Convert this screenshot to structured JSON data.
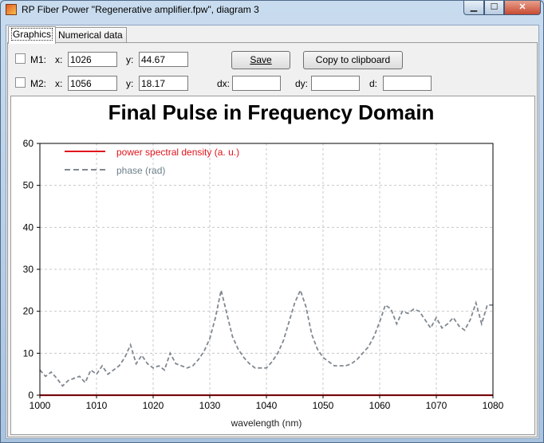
{
  "window": {
    "title": "RP Fiber Power \"Regenerative amplifier.fpw\", diagram 3",
    "controls": {
      "minimize": "▁",
      "maximize": "☐",
      "close": "✕"
    }
  },
  "tabs": [
    {
      "label": "Graphics",
      "active": true
    },
    {
      "label": "Numerical data",
      "active": false
    }
  ],
  "markers": {
    "m1": {
      "label": "M1:",
      "x_label": "x:",
      "x": "1026",
      "y_label": "y:",
      "y": "44.67",
      "checked": false
    },
    "m2": {
      "label": "M2:",
      "x_label": "x:",
      "x": "1056",
      "y_label": "y:",
      "y": "18.17",
      "checked": false
    },
    "dx_label": "dx:",
    "dx": "",
    "dy_label": "dy:",
    "dy": "",
    "d_label": "d:",
    "d": ""
  },
  "buttons": {
    "save": "Save",
    "copy": "Copy to clipboard"
  },
  "colors": {
    "psd": "#e0141c",
    "phase": "#808890",
    "legend_phase_text": "#6a7f8a",
    "grid": "#c8c8c8"
  },
  "chart_data": {
    "type": "line",
    "title": "Final Pulse in Frequency Domain",
    "xlabel": "wavelength (nm)",
    "ylabel": "",
    "xlim": [
      1000,
      1080
    ],
    "ylim": [
      0,
      60
    ],
    "xticks": [
      1000,
      1010,
      1020,
      1030,
      1040,
      1050,
      1060,
      1070,
      1080
    ],
    "yticks": [
      0,
      10,
      20,
      30,
      40,
      50,
      60
    ],
    "grid": true,
    "legend_position": "top-left",
    "series": [
      {
        "name": "power spectral density (a. u.)",
        "style": "solid",
        "x": [
          1000,
          1080
        ],
        "y": [
          0,
          0
        ]
      },
      {
        "name": "phase (rad)",
        "style": "dashed",
        "x": [
          1000,
          1001,
          1002,
          1003,
          1004,
          1005,
          1006,
          1007,
          1008,
          1009,
          1010,
          1011,
          1012,
          1013,
          1014,
          1015,
          1016,
          1017,
          1018,
          1019,
          1020,
          1021,
          1022,
          1023,
          1024,
          1025,
          1026,
          1027,
          1028,
          1029,
          1030,
          1031,
          1032,
          1033,
          1034,
          1035,
          1036,
          1037,
          1038,
          1039,
          1040,
          1041,
          1042,
          1043,
          1044,
          1045,
          1046,
          1047,
          1048,
          1049,
          1050,
          1051,
          1052,
          1053,
          1054,
          1055,
          1056,
          1057,
          1058,
          1059,
          1060,
          1061,
          1062,
          1063,
          1064,
          1065,
          1066,
          1067,
          1068,
          1069,
          1070,
          1071,
          1072,
          1073,
          1074,
          1075,
          1076,
          1077,
          1078,
          1079,
          1080
        ],
        "y": [
          6,
          4.5,
          5.5,
          4,
          2.2,
          3.5,
          4,
          4.5,
          3,
          6,
          5,
          7,
          5,
          6,
          7,
          9,
          12,
          7.5,
          9.5,
          7.5,
          6.5,
          7,
          6,
          10,
          7.5,
          7,
          6.5,
          7,
          8.5,
          10.5,
          13.5,
          18.5,
          25,
          19.5,
          14,
          11,
          9,
          7.5,
          6.5,
          6.5,
          6.5,
          8,
          10,
          13,
          17.5,
          22,
          25,
          21,
          14.5,
          11,
          9,
          8,
          7,
          7,
          7,
          7.5,
          8.5,
          10,
          11.5,
          14,
          17.5,
          21.5,
          20.5,
          17,
          20,
          19.5,
          20.5,
          20,
          18,
          16,
          18.5,
          16,
          17,
          18.5,
          16.5,
          15.5,
          18,
          22,
          17,
          21.5,
          21.5
        ]
      }
    ]
  }
}
